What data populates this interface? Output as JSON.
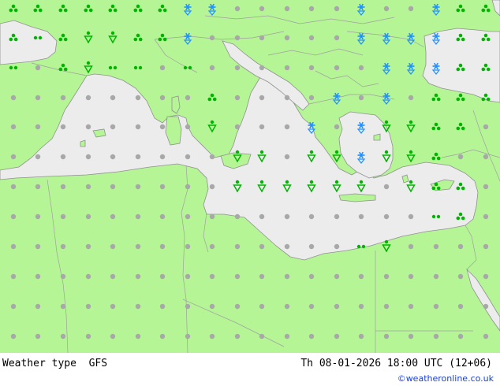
{
  "footer": {
    "caption": "Weather type  GFS",
    "valid_time": "Th 08-01-2026 18:00 UTC (12+06)",
    "credit": "©weatheronline.co.uk"
  },
  "colors": {
    "land": "#b5f596",
    "sea": "#ececec",
    "border": "#a0a0a0",
    "dry_symbol": "#a8a8a8",
    "rain_symbol": "#00b400",
    "snow_symbol": "#1e90ff"
  },
  "legend_symbols": [
    "dry-dot",
    "drizzle",
    "rain",
    "rain-shower",
    "snow",
    "snow-shower"
  ]
}
